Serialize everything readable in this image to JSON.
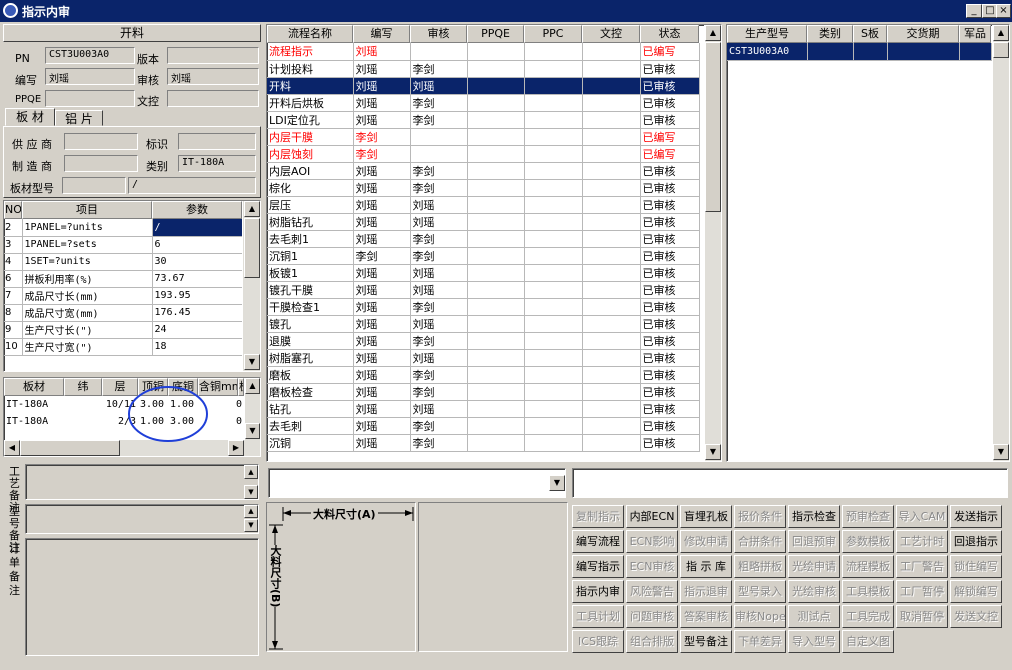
{
  "window": {
    "title": "指示内审"
  },
  "left": {
    "header": "开料",
    "pn_label": "PN",
    "pn_value": "CST3U003A0",
    "version_label": "版本",
    "version_value": "",
    "author_label": "编写",
    "author_value": "刘瑶",
    "review_label": "审核",
    "review_value": "刘瑶",
    "ppqe_label": "PPQE",
    "ppqe_value": "",
    "docctl_label": "文控",
    "docctl_value": "",
    "tabs": [
      "板 材",
      "铝 片"
    ],
    "supplier_label": "供 应 商",
    "supplier_value": "",
    "mark_label": "标识",
    "mark_value": "",
    "maker_label": "制 造 商",
    "maker_value": "",
    "category_label": "类别",
    "category_value": "IT-180A",
    "board_model_label": "板材型号",
    "board_model_value": "",
    "board_model_value2": "/",
    "params": {
      "headers": [
        "NO",
        "项目",
        "参数"
      ],
      "rows": [
        [
          "2",
          "1PANEL=?units",
          "/"
        ],
        [
          "3",
          "1PANEL=?sets",
          "6"
        ],
        [
          "4",
          "1SET=?units",
          "30"
        ],
        [
          "6",
          "拼板利用率(%)",
          "73.67"
        ],
        [
          "7",
          "成品尺寸长(mm)",
          "193.95"
        ],
        [
          "8",
          "成品尺寸宽(mm)",
          "176.45"
        ],
        [
          "9",
          "生产尺寸长(\")",
          "24"
        ],
        [
          "10",
          "生产尺寸宽(\")",
          "18"
        ]
      ]
    },
    "material": {
      "headers": [
        "板材",
        "纬",
        "层",
        "顶铜",
        "底铜",
        "含铜mm",
        "板"
      ],
      "rows": [
        [
          "IT-180A",
          "",
          "10/11",
          "3.00",
          "1.00",
          "0"
        ],
        [
          "IT-180A",
          "",
          "2/3",
          "1.00",
          "3.00",
          "0"
        ]
      ]
    },
    "process_note_label": "工艺备注",
    "model_note_label": "型号备注",
    "order_note_label": "订单备注"
  },
  "flow": {
    "headers": [
      "流程名称",
      "编写",
      "审核",
      "PPQE",
      "PPC",
      "文控",
      "状态"
    ],
    "rows": [
      {
        "name": "流程指示",
        "author": "刘瑶",
        "reviewer": "",
        "status": "已编写",
        "red": true
      },
      {
        "name": "计划投料",
        "author": "刘瑶",
        "reviewer": "李剑",
        "status": "已审核",
        "red": false
      },
      {
        "name": "开料",
        "author": "刘瑶",
        "reviewer": "刘瑶",
        "status": "已审核",
        "red": false,
        "selected": true
      },
      {
        "name": "开料后烘板",
        "author": "刘瑶",
        "reviewer": "李剑",
        "status": "已审核",
        "red": false
      },
      {
        "name": "LDI定位孔",
        "author": "刘瑶",
        "reviewer": "李剑",
        "status": "已审核",
        "red": false
      },
      {
        "name": "内层干膜",
        "author": "李剑",
        "reviewer": "",
        "status": "已编写",
        "red": true
      },
      {
        "name": "内层蚀刻",
        "author": "李剑",
        "reviewer": "",
        "status": "已编写",
        "red": true
      },
      {
        "name": "内层AOI",
        "author": "刘瑶",
        "reviewer": "李剑",
        "status": "已审核",
        "red": false
      },
      {
        "name": "棕化",
        "author": "刘瑶",
        "reviewer": "李剑",
        "status": "已审核",
        "red": false
      },
      {
        "name": "层压",
        "author": "刘瑶",
        "reviewer": "刘瑶",
        "status": "已审核",
        "red": false
      },
      {
        "name": "树脂钻孔",
        "author": "刘瑶",
        "reviewer": "刘瑶",
        "status": "已审核",
        "red": false
      },
      {
        "name": "去毛刺1",
        "author": "刘瑶",
        "reviewer": "李剑",
        "status": "已审核",
        "red": false
      },
      {
        "name": "沉铜1",
        "author": "李剑",
        "reviewer": "李剑",
        "status": "已审核",
        "red": false
      },
      {
        "name": "板镀1",
        "author": "刘瑶",
        "reviewer": "刘瑶",
        "status": "已审核",
        "red": false
      },
      {
        "name": "镀孔干膜",
        "author": "刘瑶",
        "reviewer": "刘瑶",
        "status": "已审核",
        "red": false
      },
      {
        "name": "干膜检查1",
        "author": "刘瑶",
        "reviewer": "李剑",
        "status": "已审核",
        "red": false
      },
      {
        "name": "镀孔",
        "author": "刘瑶",
        "reviewer": "刘瑶",
        "status": "已审核",
        "red": false
      },
      {
        "name": "退膜",
        "author": "刘瑶",
        "reviewer": "李剑",
        "status": "已审核",
        "red": false
      },
      {
        "name": "树脂塞孔",
        "author": "刘瑶",
        "reviewer": "刘瑶",
        "status": "已审核",
        "red": false
      },
      {
        "name": "磨板",
        "author": "刘瑶",
        "reviewer": "李剑",
        "status": "已审核",
        "red": false
      },
      {
        "name": "磨板检查",
        "author": "刘瑶",
        "reviewer": "李剑",
        "status": "已审核",
        "red": false
      },
      {
        "name": "钻孔",
        "author": "刘瑶",
        "reviewer": "刘瑶",
        "status": "已审核",
        "red": false
      },
      {
        "name": "去毛刺",
        "author": "刘瑶",
        "reviewer": "李剑",
        "status": "已审核",
        "red": false
      },
      {
        "name": "沉铜",
        "author": "刘瑶",
        "reviewer": "李剑",
        "status": "已审核",
        "red": false
      }
    ]
  },
  "model": {
    "headers": [
      "生产型号",
      "类别",
      "S板",
      "交货期",
      "军品"
    ],
    "rows": [
      [
        "CST3U003A0",
        "",
        "",
        "",
        ""
      ]
    ]
  },
  "diagram": {
    "a_label": "大料尺寸(A)",
    "b_label": "大料尺寸(B)"
  },
  "buttons": [
    [
      "复制指示",
      "内部ECN",
      "盲埋孔板",
      "报价条件",
      "指示检查",
      "预审检查",
      "导入CAM",
      "发送指示"
    ],
    [
      "编写流程",
      "ECN影响",
      "修改申请",
      "合拼条件",
      "回退预审",
      "参数模板",
      "工艺计时",
      "回退指示"
    ],
    [
      "编写指示",
      "ECN审核",
      "指 示 库",
      "粗略拼板",
      "光绘申请",
      "流程模板",
      "工厂警告",
      "锁住编写"
    ],
    [
      "指示内审",
      "风险警告",
      "指示退审",
      "型号录入",
      "光绘审核",
      "工具模板",
      "工厂暂停",
      "解锁编写"
    ],
    [
      "工具计划",
      "问题审核",
      "答案审核",
      "审核Nope",
      "测试点",
      "工具完成",
      "取消暂停",
      "发送文控"
    ],
    [
      "ICS跟踪",
      "组合排版",
      "型号备注",
      "下单差异",
      "导入型号",
      "自定义图",
      "",
      ""
    ]
  ],
  "button_enabled": [
    [
      false,
      true,
      true,
      false,
      true,
      false,
      false,
      true
    ],
    [
      true,
      false,
      false,
      false,
      false,
      false,
      false,
      true
    ],
    [
      true,
      false,
      true,
      false,
      false,
      false,
      false,
      false
    ],
    [
      true,
      false,
      false,
      false,
      false,
      false,
      false,
      false
    ],
    [
      false,
      false,
      false,
      false,
      false,
      false,
      false,
      false
    ],
    [
      false,
      false,
      true,
      false,
      false,
      false,
      false,
      false
    ]
  ]
}
